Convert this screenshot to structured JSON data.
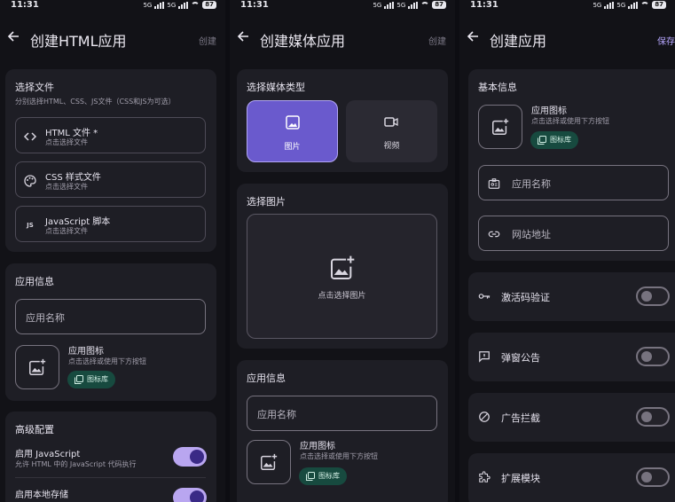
{
  "status": {
    "time": "11:31",
    "battery": "87",
    "net": "5G"
  },
  "screen1": {
    "title": "创建HTML应用",
    "action": "创建",
    "select_files": {
      "heading": "选择文件",
      "hint": "分别选择HTML、CSS、JS文件（CSS和JS为可选）",
      "items": [
        {
          "icon": "code-icon",
          "title": "HTML 文件 *",
          "sub": "点击选择文件"
        },
        {
          "icon": "palette-icon",
          "title": "CSS 样式文件",
          "sub": "点击选择文件"
        },
        {
          "icon": "js-icon",
          "glyph": "JS",
          "title": "JavaScript 脚本",
          "sub": "点击选择文件"
        }
      ]
    },
    "app_info": {
      "heading": "应用信息",
      "name_label": "应用名称",
      "icon_title": "应用图标",
      "icon_sub": "点击选择或使用下方按钮",
      "chip": "图标库"
    },
    "advanced": {
      "heading": "高级配置",
      "js_title": "启用 JavaScript",
      "js_sub": "允许 HTML 中的 JavaScript 代码执行",
      "storage_title": "启用本地存储"
    }
  },
  "screen2": {
    "title": "创建媒体应用",
    "action": "创建",
    "media_type": {
      "heading": "选择媒体类型",
      "image_label": "图片",
      "video_label": "视频"
    },
    "select_image": {
      "heading": "选择图片",
      "hint": "点击选择图片"
    },
    "app_info": {
      "heading": "应用信息",
      "name_label": "应用名称",
      "icon_title": "应用图标",
      "icon_sub": "点击选择或使用下方按钮",
      "chip": "图标库"
    }
  },
  "screen3": {
    "title": "创建应用",
    "action": "保存",
    "basic": {
      "heading": "基本信息",
      "icon_title": "应用图标",
      "icon_sub": "点击选择或使用下方按钮",
      "chip": "图标库",
      "name_label": "应用名称",
      "url_label": "网站地址"
    },
    "toggles": [
      {
        "icon": "key-icon",
        "label": "激活码验证"
      },
      {
        "icon": "announcement-icon",
        "label": "弹窗公告"
      },
      {
        "icon": "block-icon",
        "label": "广告拦截"
      },
      {
        "icon": "extension-icon",
        "label": "扩展模块"
      }
    ]
  },
  "colors": {
    "accent": "#6a5acd",
    "toggle_on": "#b9a6f0",
    "chip": "#174a3f",
    "card": "#1e1e25"
  }
}
